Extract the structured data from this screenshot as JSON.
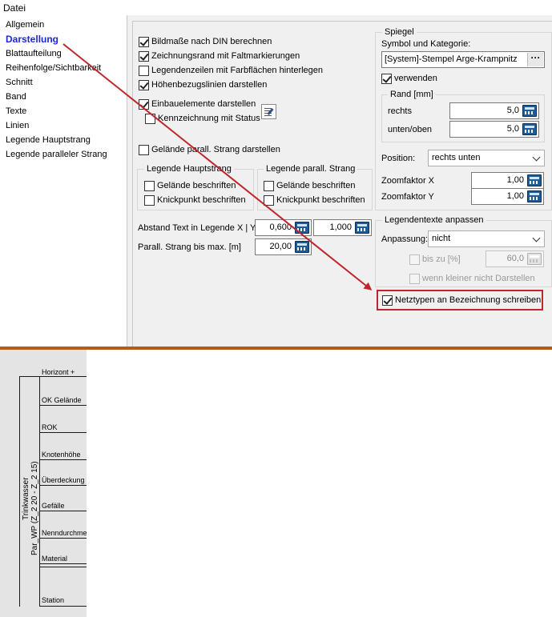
{
  "menu": {
    "file": "Datei"
  },
  "sidebar": {
    "items": [
      {
        "label": "Allgemein",
        "selected": false
      },
      {
        "label": "Darstellung",
        "selected": true
      },
      {
        "label": "Blattaufteilung",
        "selected": false
      },
      {
        "label": "Reihenfolge/Sichtbarkeit",
        "selected": false
      },
      {
        "label": "Schnitt",
        "selected": false
      },
      {
        "label": "Band",
        "selected": false
      },
      {
        "label": "Texte",
        "selected": false
      },
      {
        "label": "Linien",
        "selected": false
      },
      {
        "label": "Legende Hauptstrang",
        "selected": false
      },
      {
        "label": "Legende paralleler Strang",
        "selected": false
      }
    ]
  },
  "options": {
    "bildmasse": {
      "label": "Bildmaße nach DIN berechnen",
      "checked": true
    },
    "zeichnungsrand": {
      "label": "Zeichnungsrand mit Faltmarkierungen",
      "checked": true
    },
    "legendenzeilen": {
      "label": "Legendenzeilen mit Farbflächen hinterlegen",
      "checked": false
    },
    "hoehenbezug": {
      "label": "Höhenbezugslinien darstellen",
      "checked": true
    },
    "einbauelemente": {
      "label": "Einbauelemente darstellen",
      "checked": true
    },
    "kennzeichnung": {
      "label": "Kennzeichnung mit Status",
      "checked": false
    },
    "gelaende_parall": {
      "label": "Gelände parall. Strang darstellen",
      "checked": false
    }
  },
  "legende_haupt": {
    "title": "Legende Hauptstrang",
    "gelaende": {
      "label": "Gelände beschriften",
      "checked": false
    },
    "knickpunkt": {
      "label": "Knickpunkt beschriften",
      "checked": false
    }
  },
  "legende_parall": {
    "title": "Legende parall. Strang",
    "gelaende": {
      "label": "Gelände beschriften",
      "checked": false
    },
    "knickpunkt": {
      "label": "Knickpunkt beschriften",
      "checked": false
    }
  },
  "abstand": {
    "label": "Abstand Text in Legende X | Y:",
    "x": "0,600",
    "y": "1,000"
  },
  "parall_strang": {
    "label": "Parall. Strang bis max. [m]",
    "value": "20,00"
  },
  "spiegel": {
    "title": "Spiegel",
    "symbol_label": "Symbol und Kategorie:",
    "symbol_value": "[System]-Stempel Arge-Krampnitz",
    "dots": "···",
    "verwenden": {
      "label": "verwenden",
      "checked": true
    },
    "rand": {
      "title": "Rand [mm]",
      "rechts_label": "rechts",
      "rechts_value": "5,0",
      "unten_label": "unten/oben",
      "unten_value": "5,0"
    },
    "position": {
      "label": "Position:",
      "value": "rechts unten"
    },
    "zoom_x": {
      "label": "Zoomfaktor X",
      "value": "1,00"
    },
    "zoom_y": {
      "label": "Zoomfaktor Y",
      "value": "1,00"
    }
  },
  "legendentexte": {
    "title": "Legendentexte anpassen",
    "anpassung_label": "Anpassung:",
    "anpassung_value": "nicht",
    "bis_zu": {
      "label": "bis zu [%]",
      "checked": false,
      "value": "60,0"
    },
    "wenn_kleiner": {
      "label": "wenn kleiner nicht Darstellen",
      "checked": false
    }
  },
  "netztypen": {
    "label": "Netztypen an Bezeichnung schreiben",
    "checked": true
  },
  "colors": {
    "accent_selected": "#1a28d6",
    "annotation_red": "#c0252b",
    "separator_orange": "#b85c14"
  },
  "legend_preview": {
    "rows": [
      "Horizont +",
      "OK Gelände",
      "ROK",
      "Knotenhöhe",
      "Überdeckung",
      "Gefälle",
      "Nenndurchmesser",
      "Material",
      "Station"
    ],
    "vertical_label_1": "Trinkwasser",
    "vertical_label_2": "Par_WP  (Z_2 20 - Z_2 15)"
  }
}
